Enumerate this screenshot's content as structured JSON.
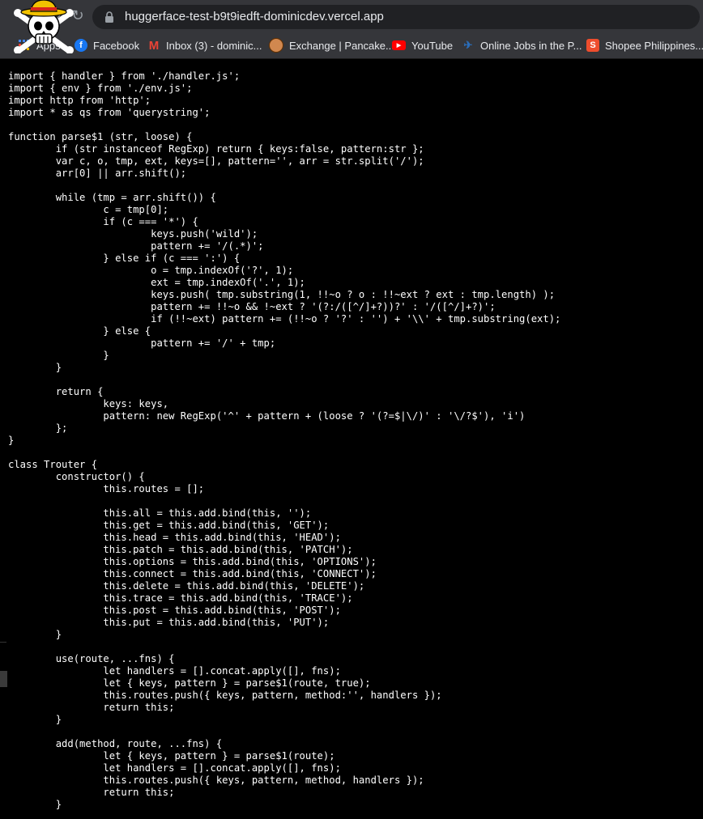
{
  "browser": {
    "url": "huggerface-test-b9t9iedft-dominicdev.vercel.app",
    "reload_icon": "reload-icon",
    "lock_icon": "lock-icon"
  },
  "bookmarks": [
    {
      "label": "Apps",
      "icon": "apps-icon",
      "color": "#4285f4"
    },
    {
      "label": "Facebook",
      "icon": "facebook-icon",
      "color": "#1877f2"
    },
    {
      "label": "Inbox (3) - dominic...",
      "icon": "gmail-icon",
      "color": "#ea4335"
    },
    {
      "label": "Exchange | Pancake...",
      "icon": "pancakeswap-icon",
      "color": "#d1884f"
    },
    {
      "label": "YouTube",
      "icon": "youtube-icon",
      "color": "#ff0000"
    },
    {
      "label": "Online Jobs in the P...",
      "icon": "onlinejobs-icon",
      "color": "#2a6ebb"
    },
    {
      "label": "Shopee Philippines...",
      "icon": "shopee-icon",
      "color": "#ee4d2d"
    }
  ],
  "code": "import { handler } from './handler.js';\nimport { env } from './env.js';\nimport http from 'http';\nimport * as qs from 'querystring';\n\nfunction parse$1 (str, loose) {\n\tif (str instanceof RegExp) return { keys:false, pattern:str };\n\tvar c, o, tmp, ext, keys=[], pattern='', arr = str.split('/');\n\tarr[0] || arr.shift();\n\n\twhile (tmp = arr.shift()) {\n\t\tc = tmp[0];\n\t\tif (c === '*') {\n\t\t\tkeys.push('wild');\n\t\t\tpattern += '/(.*)';\n\t\t} else if (c === ':') {\n\t\t\to = tmp.indexOf('?', 1);\n\t\t\text = tmp.indexOf('.', 1);\n\t\t\tkeys.push( tmp.substring(1, !!~o ? o : !!~ext ? ext : tmp.length) );\n\t\t\tpattern += !!~o && !~ext ? '(?:/([^/]+?))?' : '/([^/]+?)';\n\t\t\tif (!!~ext) pattern += (!!~o ? '?' : '') + '\\\\' + tmp.substring(ext);\n\t\t} else {\n\t\t\tpattern += '/' + tmp;\n\t\t}\n\t}\n\n\treturn {\n\t\tkeys: keys,\n\t\tpattern: new RegExp('^' + pattern + (loose ? '(?=$|\\/)' : '\\/?$'), 'i')\n\t};\n}\n\nclass Trouter {\n\tconstructor() {\n\t\tthis.routes = [];\n\n\t\tthis.all = this.add.bind(this, '');\n\t\tthis.get = this.add.bind(this, 'GET');\n\t\tthis.head = this.add.bind(this, 'HEAD');\n\t\tthis.patch = this.add.bind(this, 'PATCH');\n\t\tthis.options = this.add.bind(this, 'OPTIONS');\n\t\tthis.connect = this.add.bind(this, 'CONNECT');\n\t\tthis.delete = this.add.bind(this, 'DELETE');\n\t\tthis.trace = this.add.bind(this, 'TRACE');\n\t\tthis.post = this.add.bind(this, 'POST');\n\t\tthis.put = this.add.bind(this, 'PUT');\n\t}\n\n\tuse(route, ...fns) {\n\t\tlet handlers = [].concat.apply([], fns);\n\t\tlet { keys, pattern } = parse$1(route, true);\n\t\tthis.routes.push({ keys, pattern, method:'', handlers });\n\t\treturn this;\n\t}\n\n\tadd(method, route, ...fns) {\n\t\tlet { keys, pattern } = parse$1(route);\n\t\tlet handlers = [].concat.apply([], fns);\n\t\tthis.routes.push({ keys, pattern, method, handlers });\n\t\treturn this;\n\t}"
}
